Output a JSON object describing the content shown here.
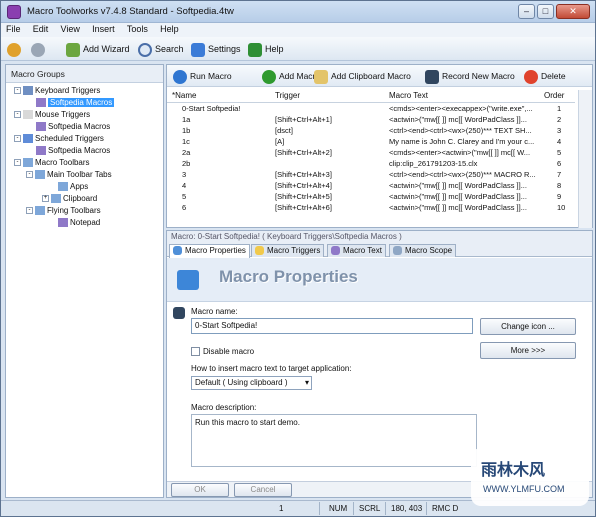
{
  "window": {
    "title": "Macro Toolworks v7.4.8 Standard - Softpedia.4tw"
  },
  "menu": [
    "File",
    "Edit",
    "View",
    "Insert",
    "Tools",
    "Help"
  ],
  "toolbar": {
    "add_wizard": "Add Wizard",
    "search": "Search",
    "settings": "Settings",
    "help": "Help"
  },
  "left": {
    "header": "Macro Groups",
    "tree": [
      {
        "label": "Keyboard Triggers",
        "level": 1,
        "exp": "-",
        "icon": "keyboard"
      },
      {
        "label": "Softpedia Macros",
        "level": 2,
        "selected": true,
        "icon": "group"
      },
      {
        "label": "Mouse Triggers",
        "level": 1,
        "exp": "-",
        "icon": "mouse"
      },
      {
        "label": "Softpedia Macros",
        "level": 2,
        "icon": "group"
      },
      {
        "label": "Scheduled Triggers",
        "level": 1,
        "exp": "-",
        "icon": "schedule"
      },
      {
        "label": "Softpedia Macros",
        "level": 2,
        "icon": "group"
      },
      {
        "label": "Macro Toolbars",
        "level": 1,
        "exp": "-",
        "icon": "toolbar"
      },
      {
        "label": "Main Toolbar Tabs",
        "level": 2,
        "exp": "-",
        "icon": "toolbar"
      },
      {
        "label": "Apps",
        "level": 3,
        "icon": "folder"
      },
      {
        "label": "Clipboard",
        "level": 3,
        "exp": "+",
        "icon": "folder"
      },
      {
        "label": "Flying Toolbars",
        "level": 2,
        "exp": "-",
        "icon": "toolbar"
      },
      {
        "label": "Notepad",
        "level": 3,
        "icon": "group"
      }
    ]
  },
  "macro_toolbar": {
    "run": "Run Macro",
    "add": "Add Macro",
    "add_clip": "Add Clipboard Macro",
    "record": "Record New Macro",
    "delete": "Delete"
  },
  "grid": {
    "headers": [
      "*Name",
      "Trigger",
      "Macro Text",
      "Order"
    ],
    "rows": [
      {
        "name": "0-Start Softpedia!",
        "trigger": "",
        "text": "<cmds><enter><execappex>(\"write.exe\",...",
        "order": "1",
        "selected": true
      },
      {
        "name": "1a",
        "trigger": "[Shift+Ctrl+Alt+1]",
        "text": "<actwin>(\"mw[[ ]] mc[[ WordPadClass ]]...",
        "order": "2"
      },
      {
        "name": "1b",
        "trigger": "[dsct]",
        "text": "<ctrl><end><ctrl><wx>(250)*** TEXT SH...",
        "order": "3"
      },
      {
        "name": "1c",
        "trigger": "[A]",
        "text": "My name is John C. Clarey and I'm your c...",
        "order": "4"
      },
      {
        "name": "2a",
        "trigger": "[Shift+Ctrl+Alt+2]",
        "text": "<cmds><enter><actwin>(\"mw[[ ]] mc[[ W...",
        "order": "5"
      },
      {
        "name": "2b",
        "trigger": "",
        "text": "clip:clip_261791203-15.clx",
        "order": "6"
      },
      {
        "name": "3",
        "trigger": "[Shift+Ctrl+Alt+3]",
        "text": "<ctrl><end><ctrl><wx>(250)*** MACRO R...",
        "order": "7"
      },
      {
        "name": "4",
        "trigger": "[Shift+Ctrl+Alt+4]",
        "text": "<actwin>(\"mw[[ ]] mc[[ WordPadClass ]]...",
        "order": "8"
      },
      {
        "name": "5",
        "trigger": "[Shift+Ctrl+Alt+5]",
        "text": "<actwin>(\"mw[[ ]] mc[[ WordPadClass ]]...",
        "order": "9"
      },
      {
        "name": "6",
        "trigger": "[Shift+Ctrl+Alt+6]",
        "text": "<actwin>(\"mw[[ ]] mc[[ WordPadClass ]]...",
        "order": "10"
      }
    ]
  },
  "lower": {
    "path": "Macro: 0-Start Softpedia! ( Keyboard Triggers\\Softpedia Macros )",
    "tabs": [
      "Macro Properties",
      "Macro Triggers",
      "Macro Text",
      "Macro Scope"
    ],
    "header_title": "Macro Properties",
    "macro_name_label": "Macro name:",
    "macro_name_value": "0-Start Softpedia!",
    "change_icon": "Change icon ...",
    "disable_macro": "Disable macro",
    "more": "More >>>",
    "insert_label": "How to insert macro text to target application:",
    "insert_value": "Default ( Using clipboard )",
    "description_label": "Macro description:",
    "description_value": "Run this macro to start demo.",
    "ok": "OK",
    "cancel": "Cancel"
  },
  "statusbar": {
    "count": "1",
    "num": "NUM",
    "scrl": "SCRL",
    "coords": "180, 403",
    "mode": "RMC D"
  },
  "watermark": {
    "text1": "雨林木风",
    "text2": "WWW.YLMFU.COM"
  }
}
